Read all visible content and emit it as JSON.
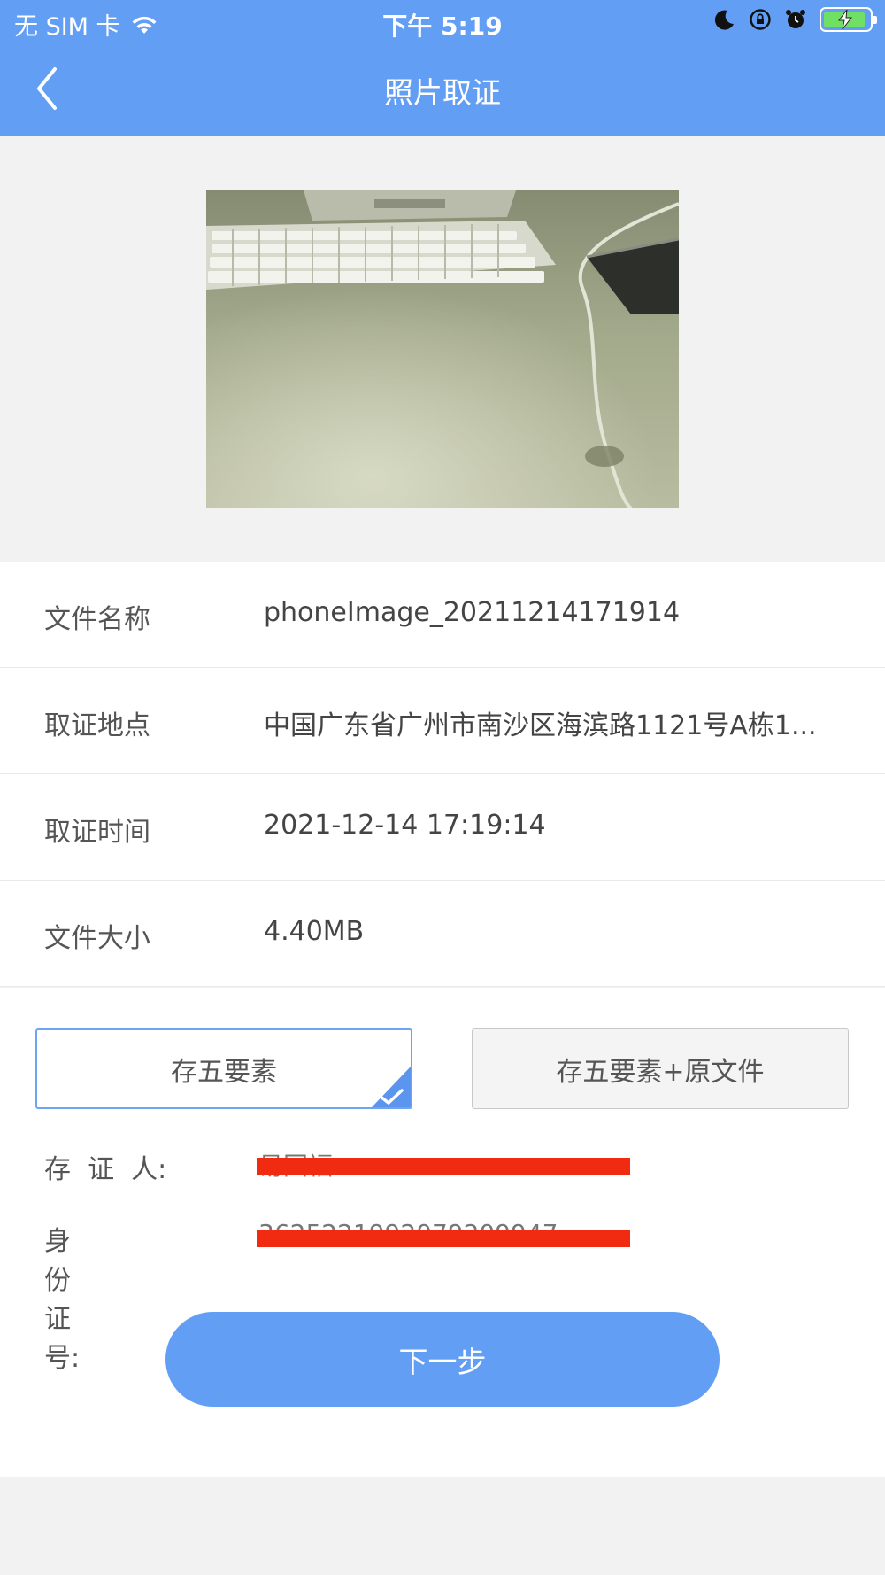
{
  "status_bar": {
    "carrier": "无 SIM 卡",
    "time": "下午 5:19"
  },
  "nav": {
    "title": "照片取证"
  },
  "info": [
    {
      "label": "文件名称",
      "value": "phoneImage_20211214171914"
    },
    {
      "label": "取证地点",
      "value": "中国广东省广州市南沙区海滨路1121号A栋1..."
    },
    {
      "label": "取证时间",
      "value": "2021-12-14 17:19:14"
    },
    {
      "label": "文件大小",
      "value": "4.40MB"
    }
  ],
  "options": {
    "option1": "存五要素",
    "option2": "存五要素+原文件",
    "selected": "存五要素"
  },
  "person": {
    "holder_label": "存  证  人:",
    "holder_value": "易国福",
    "id_label": "身份证号:",
    "id_value": "3625221992079209947"
  },
  "next_button": "下一步",
  "colors": {
    "primary": "#619ef4",
    "background": "#f2f2f3",
    "redaction": "#f12a12"
  }
}
